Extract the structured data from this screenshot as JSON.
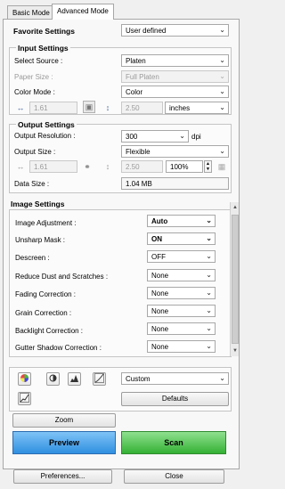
{
  "tabs": [
    {
      "label": "Basic Mode"
    },
    {
      "label": "Advanced Mode"
    }
  ],
  "favorite": {
    "label": "Favorite Settings",
    "value": "User defined"
  },
  "input_settings": {
    "heading": "Input Settings",
    "select_source": {
      "label": "Select Source :",
      "value": "Platen"
    },
    "paper_size": {
      "label": "Paper Size :",
      "value": "Full Platen"
    },
    "color_mode": {
      "label": "Color Mode :",
      "value": "Color"
    },
    "width": "1.61",
    "height": "2.50",
    "unit": "inches"
  },
  "output_settings": {
    "heading": "Output Settings",
    "resolution": {
      "label": "Output Resolution :",
      "value": "300",
      "unit": "dpi"
    },
    "size": {
      "label": "Output Size :",
      "value": "Flexible"
    },
    "width": "1.61",
    "height": "2.50",
    "scale": "100%",
    "data_size": {
      "label": "Data Size :",
      "value": "1.04 MB"
    }
  },
  "image_settings": {
    "heading": "Image Settings",
    "items": [
      {
        "label": "Image Adjustment :",
        "value": "Auto",
        "bold": true
      },
      {
        "label": "Unsharp Mask :",
        "value": "ON",
        "bold": true
      },
      {
        "label": "Descreen :",
        "value": "OFF",
        "bold": false
      },
      {
        "label": "Reduce Dust and Scratches :",
        "value": "None",
        "bold": false
      },
      {
        "label": "Fading Correction :",
        "value": "None",
        "bold": false
      },
      {
        "label": "Grain Correction :",
        "value": "None",
        "bold": false
      },
      {
        "label": "Backlight Correction :",
        "value": "None",
        "bold": false
      },
      {
        "label": "Gutter Shadow Correction :",
        "value": "None",
        "bold": false
      }
    ]
  },
  "tools": {
    "preset": "Custom",
    "defaults_label": "Defaults"
  },
  "buttons": {
    "zoom": "Zoom",
    "preview": "Preview",
    "scan": "Scan",
    "preferences": "Preferences...",
    "close": "Close"
  },
  "colors": {
    "preview": "#3a96e6",
    "scan": "#3cb53c"
  }
}
